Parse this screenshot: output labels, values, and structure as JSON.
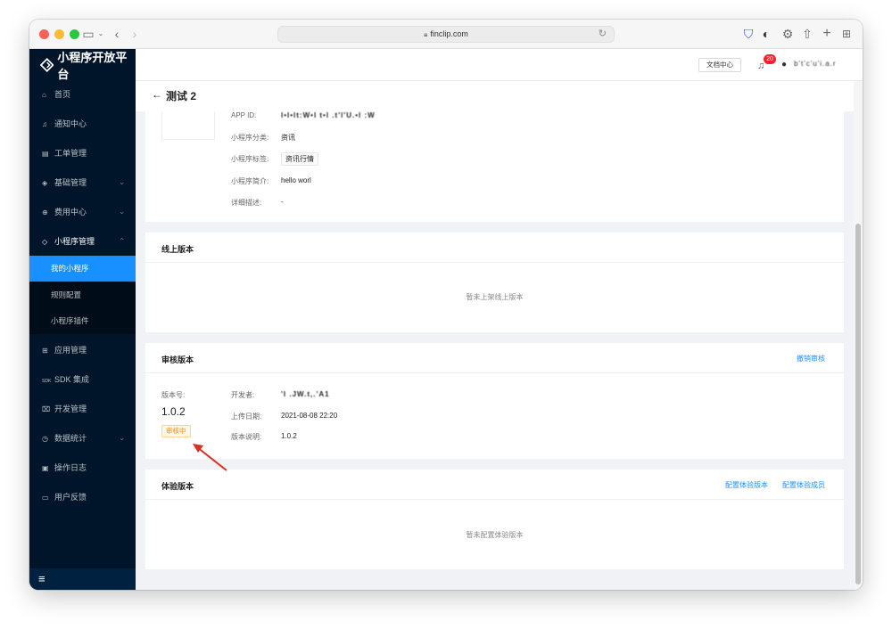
{
  "browser": {
    "url": "finclip.com"
  },
  "sidebar": {
    "brand": "小程序开放平台",
    "items": [
      {
        "label": "首页",
        "icon": "home-icon"
      },
      {
        "label": "通知中心",
        "icon": "bell-icon"
      },
      {
        "label": "工单管理",
        "icon": "ticket-icon"
      },
      {
        "label": "基础管理",
        "icon": "layers-icon"
      },
      {
        "label": "费用中心",
        "icon": "coin-icon"
      },
      {
        "label": "小程序管理",
        "icon": "diamond-icon"
      }
    ],
    "sub_items": [
      {
        "label": "我的小程序",
        "active": true
      },
      {
        "label": "规则配置",
        "active": false
      },
      {
        "label": "小程序插件",
        "active": false
      }
    ],
    "items_after": [
      {
        "label": "应用管理",
        "icon": "grid-icon"
      },
      {
        "label": "SDK 集成",
        "icon": "sdk-icon"
      },
      {
        "label": "开发管理",
        "icon": "code-icon"
      },
      {
        "label": "数据统计",
        "icon": "clock-icon"
      },
      {
        "label": "操作日志",
        "icon": "log-icon"
      },
      {
        "label": "用户反馈",
        "icon": "feedback-icon"
      }
    ],
    "footer_icon": "≡"
  },
  "header": {
    "doc_center": "文档中心",
    "notification_count": "20",
    "user_name": "b't'c'u'i.a.r"
  },
  "page": {
    "title": "测试 2"
  },
  "app_info": {
    "rows": [
      {
        "label": "APP ID:",
        "value": "l•l•lt:W•l t•l .t'l'U.•l :W"
      },
      {
        "label": "小程序分类:",
        "value": "资讯"
      },
      {
        "label": "小程序标签:",
        "value": "资讯行情"
      },
      {
        "label": "小程序简介:",
        "value": "hello worl"
      },
      {
        "label": "详细描述:",
        "value": "-"
      }
    ]
  },
  "online_version": {
    "title": "线上版本",
    "empty": "暂未上架线上版本"
  },
  "review_version": {
    "title": "审核版本",
    "action": "撤销审核",
    "version_label": "版本号:",
    "version": "1.0.2",
    "status": "审核中",
    "developer_label": "开发者:",
    "developer": "'I .JW.t,.'A1",
    "upload_date_label": "上传日期:",
    "upload_date": "2021-08-08 22:20",
    "notes_label": "版本说明:",
    "notes": "1.0.2"
  },
  "trial_version": {
    "title": "体验版本",
    "action1": "配置体验版本",
    "action2": "配置体验成员",
    "empty": "暂未配置体验版本"
  },
  "colors": {
    "sidebar_bg": "#001529",
    "accent": "#1890ff",
    "status_orange": "#fa8c16",
    "annotation_red": "#d93025"
  }
}
